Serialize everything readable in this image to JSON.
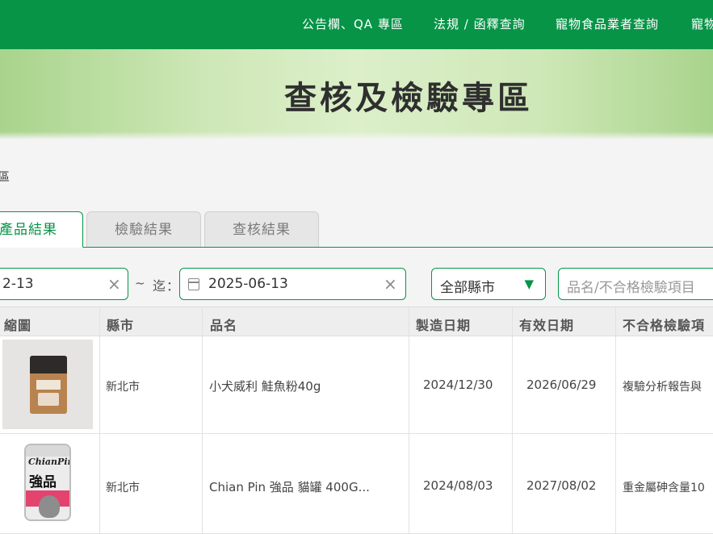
{
  "nav": {
    "items": [
      "公告欄、QA 專區",
      "法規 / 函釋查詢",
      "寵物食品業者查詢",
      "寵物"
    ]
  },
  "hero": {
    "title": "查核及檢驗專區"
  },
  "breadcrumb": {
    "current": "專區"
  },
  "tabs": [
    {
      "label": "產品結果",
      "active": true
    },
    {
      "label": "檢驗結果",
      "active": false
    },
    {
      "label": "查核結果",
      "active": false
    }
  ],
  "filters": {
    "start_date": "2-13",
    "clear_symbol": "×",
    "tilde": "~",
    "until_label": "迄：",
    "end_date": "2025-06-13",
    "county_select": "全部縣市",
    "select_arrow": "▼",
    "search_placeholder": "品名/不合格檢驗項目"
  },
  "table": {
    "headers": [
      "縮圖",
      "縣市",
      "品名",
      "製造日期",
      "有效日期",
      "不合格檢驗項"
    ],
    "rows": [
      {
        "county": "新北市",
        "name": "小犬威利 鮭魚粉40g",
        "mfg_date": "2024/12/30",
        "exp_date": "2026/06/29",
        "failed_item": "複驗分析報告與"
      },
      {
        "county": "新北市",
        "name": "Chian Pin 強品 貓罐 400G...",
        "mfg_date": "2024/08/03",
        "exp_date": "2027/08/02",
        "failed_item": "重金屬砷含量10"
      }
    ],
    "thumb2_brand": "ChianPin",
    "thumb2_big": "強品"
  },
  "colors": {
    "brand_green": "#079447",
    "accent_pink": "#e2446f"
  }
}
